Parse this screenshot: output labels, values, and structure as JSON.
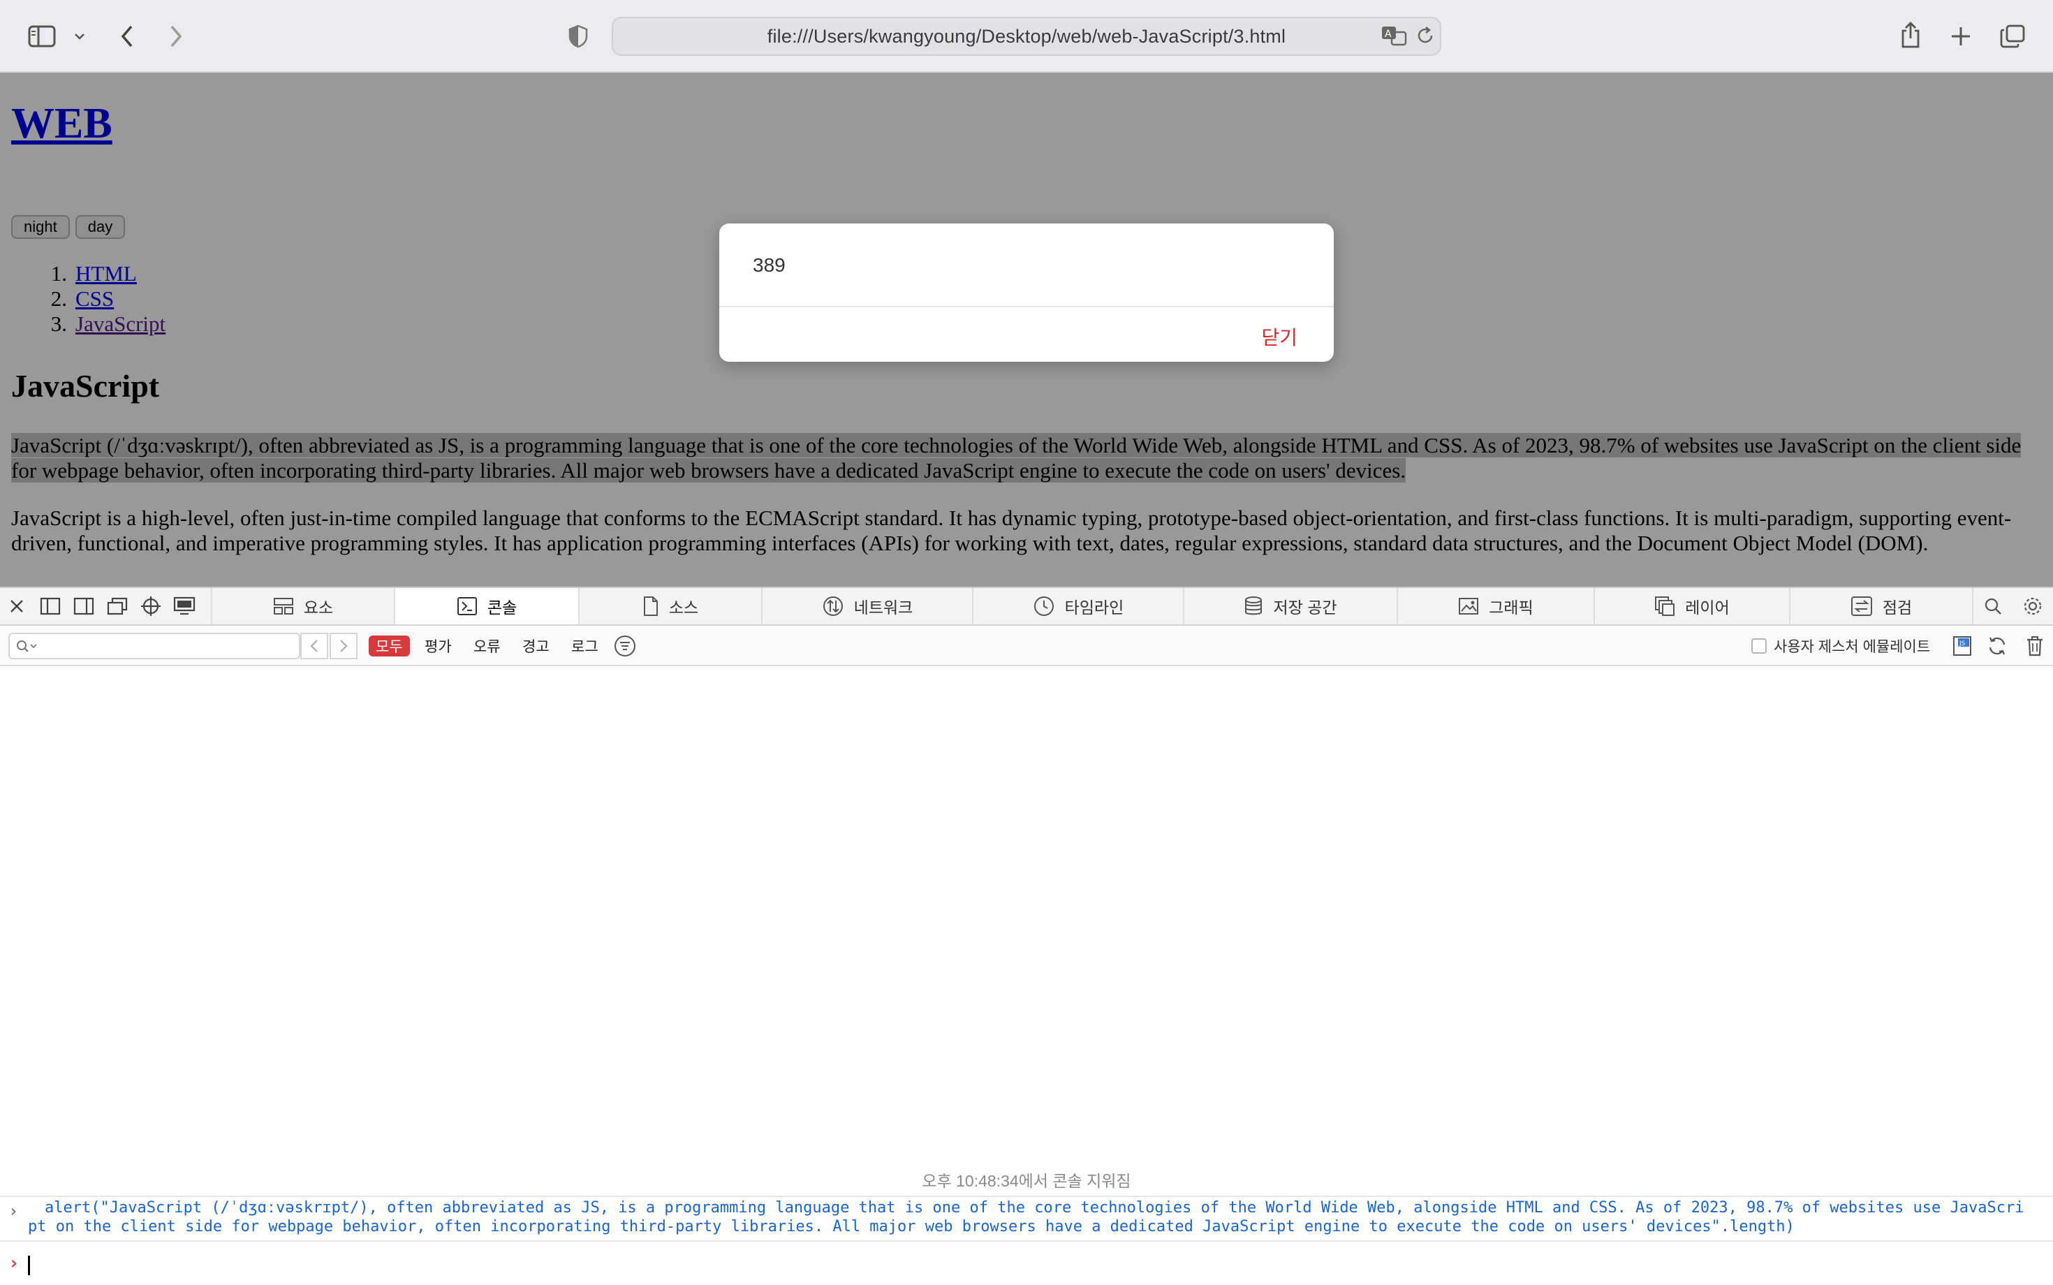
{
  "browser": {
    "url": "file:///Users/kwangyoung/Desktop/web/web-JavaScript/3.html"
  },
  "page": {
    "site_title": "WEB",
    "mode_buttons": [
      "night",
      "day"
    ],
    "nav": [
      {
        "num": "1.",
        "label": "HTML"
      },
      {
        "num": "2.",
        "label": "CSS"
      },
      {
        "num": "3.",
        "label": "JavaScript"
      }
    ],
    "section_title": "JavaScript",
    "paragraph1": "JavaScript (/ˈdʒɑːvəskrɪpt/), often abbreviated as JS, is a programming language that is one of the core technologies of the World Wide Web, alongside HTML and CSS. As of 2023, 98.7% of websites use JavaScript on the client side for webpage behavior, often incorporating third-party libraries. All major web browsers have a dedicated JavaScript engine to execute the code on users' devices.",
    "paragraph2": "JavaScript is a high-level, often just-in-time compiled language that conforms to the ECMAScript standard. It has dynamic typing, prototype-based object-orientation, and first-class functions. It is multi-paradigm, supporting event-driven, functional, and imperative programming styles. It has application programming interfaces (APIs) for working with text, dates, regular expressions, standard data structures, and the Document Object Model (DOM)."
  },
  "dialog": {
    "message": "389",
    "close_label": "닫기"
  },
  "devtools": {
    "tabs": [
      "요소",
      "콘솔",
      "소스",
      "네트워크",
      "타임라인",
      "저장 공간",
      "그래픽",
      "레이어",
      "점검"
    ],
    "active_tab": "콘솔",
    "filter_levels": [
      "모두",
      "평가",
      "오류",
      "경고",
      "로그"
    ],
    "gesture_label": "사용자 제스처 에뮬레이트",
    "clear_message": "오후 10:48:34에서 콘솔 지워짐",
    "entry": "alert(\"JavaScript (/ˈdʒɑːvəskrɪpt/), often abbreviated as JS, is a programming language that is one of the core technologies of the World Wide Web, alongside HTML and CSS. As of 2023, 98.7% of websites use JavaScript on the client side for webpage behavior, often incorporating third-party libraries. All major web browsers have a dedicated JavaScript engine to execute the code on users' devices\".length)"
  }
}
